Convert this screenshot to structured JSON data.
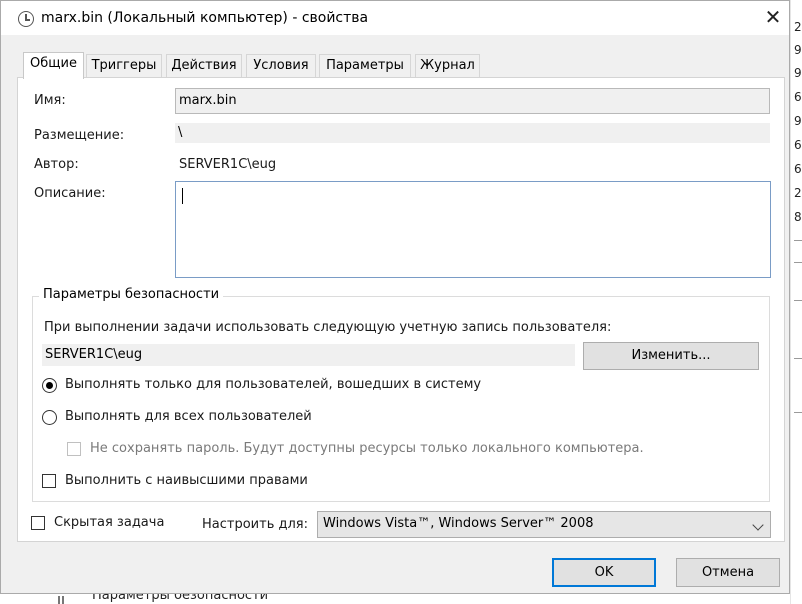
{
  "window": {
    "title": "marx.bin (Локальный компьютер) - свойства",
    "close_glyph": "✕"
  },
  "tabs": [
    "Общие",
    "Триггеры",
    "Действия",
    "Условия",
    "Параметры",
    "Журнал"
  ],
  "general": {
    "name_label": "Имя:",
    "name_value": "marx.bin",
    "location_label": "Размещение:",
    "location_value": "\\",
    "author_label": "Автор:",
    "author_value": "SERVER1C\\eug",
    "description_label": "Описание:",
    "description_value": ""
  },
  "security": {
    "group_title": "Параметры безопасности",
    "account_prompt": "При выполнении задачи использовать следующую учетную запись пользователя:",
    "account_value": "SERVER1C\\eug",
    "change_button": "Изменить...",
    "radio_logged_on": "Выполнять только для пользователей, вошедших в систему",
    "radio_all_users": "Выполнять для всех пользователей",
    "do_not_store_password": "Не сохранять пароль. Будут доступны ресурсы только локального компьютера.",
    "run_highest_privileges": "Выполнить с наивысшими правами",
    "selected_radio": "logged_on"
  },
  "bottom": {
    "hidden_task": "Скрытая задача",
    "configure_for_label": "Настроить для:",
    "configure_for_value": "Windows Vista™, Windows Server™ 2008"
  },
  "buttons": {
    "ok": "OK",
    "cancel": "Отмена"
  },
  "background": {
    "right_column_digits": [
      "2",
      "9",
      "9",
      "6",
      "9",
      "6",
      "6",
      "2",
      "8"
    ],
    "bottom_text": "Параметры безопасности"
  },
  "colors": {
    "accent": "#0078d7",
    "dialog_bg": "#f0f0f0",
    "panel_bg": "#ffffff"
  }
}
